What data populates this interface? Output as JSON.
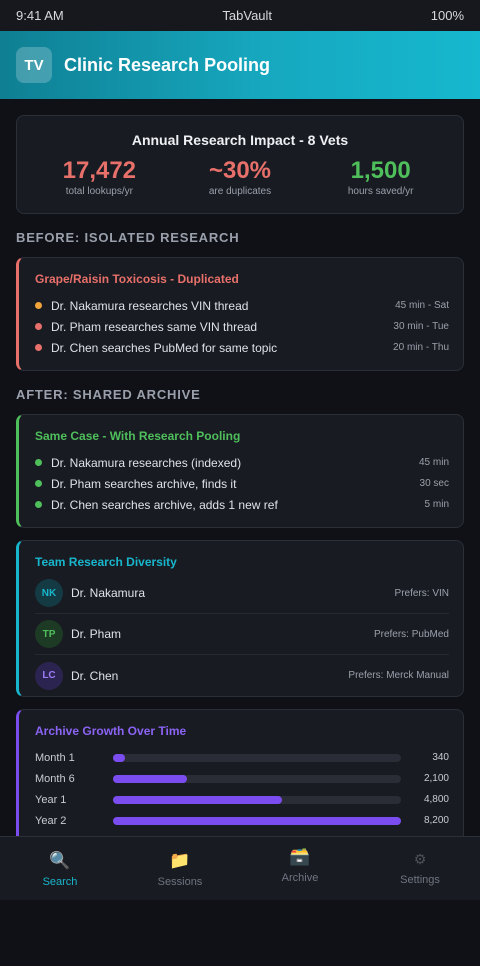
{
  "status_bar": {
    "time": "9:41 AM",
    "app": "TabVault",
    "battery": "100%"
  },
  "header": {
    "logo": "TV",
    "title": "Clinic Research Pooling"
  },
  "impact": {
    "title": "Annual Research Impact - 8 Vets",
    "stats": [
      {
        "value": "17,472",
        "label": "total lookups/yr",
        "color": "#e8706a"
      },
      {
        "value": "~30%",
        "label": "are duplicates",
        "color": "#e8706a"
      },
      {
        "value": "1,500",
        "label": "hours saved/yr",
        "color": "#4fbf5b"
      }
    ]
  },
  "before": {
    "section_title": "BEFORE: ISOLATED RESEARCH",
    "heading": "Grape/Raisin Toxicosis - Duplicated",
    "accent": "#e8706a",
    "rows": [
      {
        "text": "Dr. Nakamura researches VIN thread",
        "meta": "45 min - Sat",
        "dot": "#f0a43a"
      },
      {
        "text": "Dr. Pham researches same VIN thread",
        "meta": "30 min - Tue",
        "dot": "#e8706a"
      },
      {
        "text": "Dr. Chen searches PubMed for same topic",
        "meta": "20 min - Thu",
        "dot": "#e8706a"
      }
    ]
  },
  "after": {
    "section_title": "AFTER: SHARED ARCHIVE",
    "heading": "Same Case - With Research Pooling",
    "accent": "#4fbf5b",
    "rows": [
      {
        "text": "Dr. Nakamura researches (indexed)",
        "meta": "45 min",
        "dot": "#4fbf5b"
      },
      {
        "text": "Dr. Pham searches archive, finds it",
        "meta": "30 sec",
        "dot": "#4fbf5b"
      },
      {
        "text": "Dr. Chen searches archive, adds 1 new ref",
        "meta": "5 min",
        "dot": "#4fbf5b"
      }
    ]
  },
  "team": {
    "heading": "Team Research Diversity",
    "members": [
      {
        "initials": "NK",
        "name": "Dr. Nakamura",
        "pref": "Prefers: VIN",
        "fg": "#18b6cc",
        "bg": "#143a44"
      },
      {
        "initials": "TP",
        "name": "Dr. Pham",
        "pref": "Prefers: PubMed",
        "fg": "#4fbf5b",
        "bg": "#1d3a24"
      },
      {
        "initials": "LC",
        "name": "Dr. Chen",
        "pref": "Prefers: Merck Manual",
        "fg": "#9b7bf5",
        "bg": "#2c2450"
      }
    ]
  },
  "growth": {
    "heading": "Archive Growth Over Time",
    "max": 8200,
    "bars": [
      {
        "label": "Month 1",
        "value": 340,
        "display": "340"
      },
      {
        "label": "Month 6",
        "value": 2100,
        "display": "2,100"
      },
      {
        "label": "Year 1",
        "value": 4800,
        "display": "4,800"
      },
      {
        "label": "Year 2",
        "value": 8200,
        "display": "8,200"
      }
    ]
  },
  "nav": {
    "items": [
      {
        "label": "Search",
        "icon": "magnifier-icon",
        "glyph": "🔍"
      },
      {
        "label": "Sessions",
        "icon": "folder-icon",
        "glyph": "📁"
      },
      {
        "label": "Archive",
        "icon": "card-file-box-icon",
        "glyph": "🗃️"
      },
      {
        "label": "Settings",
        "icon": "gear-icon",
        "glyph": "⚙"
      }
    ],
    "active_color": "#18b6cc"
  }
}
